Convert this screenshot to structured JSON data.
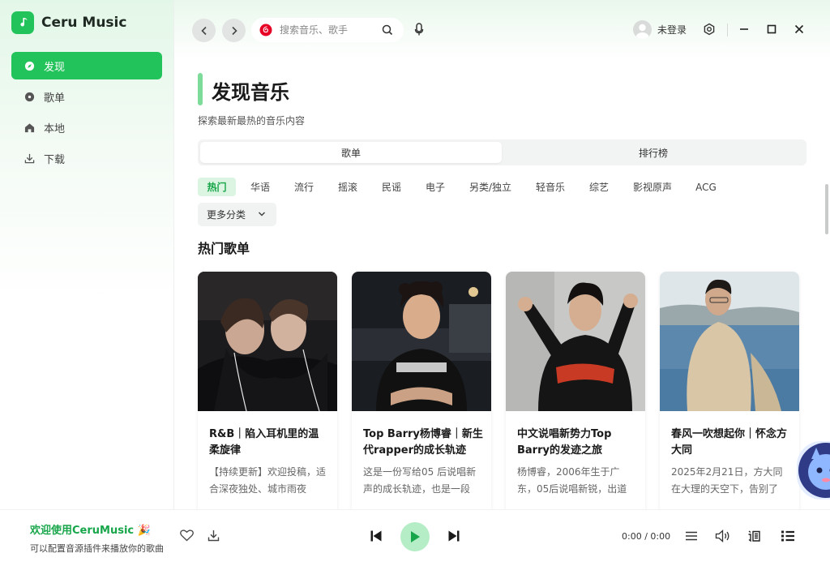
{
  "app": {
    "name": "Ceru Music",
    "accent": "#22c35a"
  },
  "sidebar": {
    "items": [
      {
        "label": "发现",
        "icon": "compass-icon",
        "active": true
      },
      {
        "label": "歌单",
        "icon": "disc-icon",
        "active": false
      },
      {
        "label": "本地",
        "icon": "home-icon",
        "active": false
      },
      {
        "label": "下载",
        "icon": "download-icon",
        "active": false
      }
    ]
  },
  "header": {
    "search_placeholder": "搜索音乐、歌手",
    "user_name": "未登录"
  },
  "main": {
    "title": "发现音乐",
    "subtitle": "探索最新最热的音乐内容",
    "tabs": [
      {
        "label": "歌单",
        "active": true
      },
      {
        "label": "排行榜",
        "active": false
      }
    ],
    "categories": [
      "热门",
      "华语",
      "流行",
      "摇滚",
      "民谣",
      "电子",
      "另类/独立",
      "轻音乐",
      "综艺",
      "影视原声",
      "ACG"
    ],
    "active_category": "热门",
    "more_categories": "更多分类",
    "section_title": "热门歌单",
    "playlists": [
      {
        "title": "R&B｜陷入耳机里的温柔旋律",
        "desc": "【持续更新】欢迎投稿，适合深夜独处、城市雨夜"
      },
      {
        "title": "Top Barry杨博睿｜新生代rapper的成长轨迹",
        "desc": "这是一份写给05 后说唱新声的成长轨迹，也是一段"
      },
      {
        "title": "中文说唱新势力Top Barry的发迹之旅",
        "desc": "杨博睿，2006年生于广东，05后说唱新锐，出道"
      },
      {
        "title": "春风一吹想起你｜怀念方大同",
        "desc": "2025年2月21日，方大同在大理的天空下，告别了"
      }
    ]
  },
  "player": {
    "welcome": "欢迎使用CeruMusic 🎉",
    "welcome_sub": "可以配置音源插件来播放你的歌曲",
    "time": "0:00 / 0:00"
  }
}
